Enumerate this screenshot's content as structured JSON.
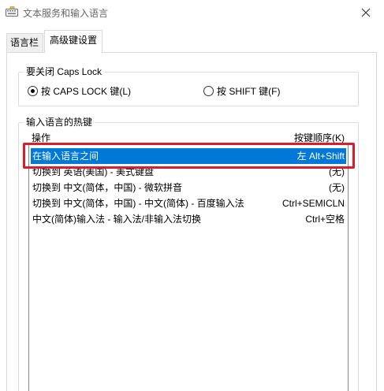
{
  "window": {
    "title": "文本服务和输入语言",
    "icon": "keyboard-settings-icon"
  },
  "tabs": [
    {
      "label": "语言栏",
      "active": false
    },
    {
      "label": "高级键设置",
      "active": true
    }
  ],
  "caps_group": {
    "legend": "要关闭 Caps Lock",
    "options": [
      {
        "label": "按 CAPS LOCK 键(L)",
        "checked": true
      },
      {
        "label": "按 SHIFT 键(F)",
        "checked": false
      }
    ]
  },
  "hotkey_group": {
    "legend": "输入语言的热键",
    "columns": {
      "action": "操作",
      "sequence": "按键顺序(K)"
    },
    "rows": [
      {
        "action": "在输入语言之间",
        "sequence": "左 Alt+Shift",
        "selected": true
      },
      {
        "action": "切换到 英语(美国) - 美式键盘",
        "sequence": "(无)",
        "selected": false
      },
      {
        "action": "切换到 中文(简体，中国) - 微软拼音",
        "sequence": "(无)",
        "selected": false
      },
      {
        "action": "切换到 中文(简体，中国) - 中文(简体) - 百度输入法",
        "sequence": "Ctrl+SEMICLN",
        "selected": false
      },
      {
        "action": "中文(简体)输入法 - 输入法/非输入法切换",
        "sequence": "Ctrl+空格",
        "selected": false
      }
    ]
  },
  "colors": {
    "selection": "#0078d7",
    "annotation_box": "#d81e2c"
  }
}
